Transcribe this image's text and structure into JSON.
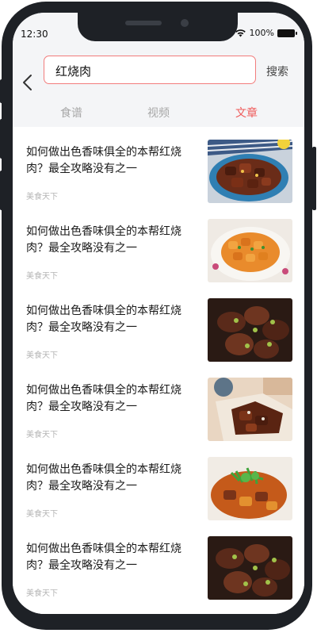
{
  "status": {
    "time": "12:30",
    "battery_text": "100%"
  },
  "search": {
    "value": "红烧肉",
    "button_label": "搜索"
  },
  "tabs": [
    {
      "label": "食谱",
      "active": false
    },
    {
      "label": "视频",
      "active": false
    },
    {
      "label": "文章",
      "active": true
    }
  ],
  "articles": [
    {
      "title": "如何做出色香味俱全的本帮红烧肉？最全攻略没有之一",
      "source": "美食天下"
    },
    {
      "title": "如何做出色香味俱全的本帮红烧肉？最全攻略没有之一",
      "source": "美食天下"
    },
    {
      "title": "如何做出色香味俱全的本帮红烧肉？最全攻略没有之一",
      "source": "美食天下"
    },
    {
      "title": "如何做出色香味俱全的本帮红烧肉？最全攻略没有之一",
      "source": "美食天下"
    },
    {
      "title": "如何做出色香味俱全的本帮红烧肉？最全攻略没有之一",
      "source": "美食天下"
    },
    {
      "title": "如何做出色香味俱全的本帮红烧肉？最全攻略没有之一",
      "source": "美食天下"
    }
  ],
  "colors": {
    "accent": "#ef5a5a",
    "search_border": "#f27c7c",
    "header_bg": "#f4f5f7",
    "frame": "#1e2126"
  },
  "icons": [
    "back-chevron-icon",
    "wifi-icon",
    "battery-icon"
  ]
}
